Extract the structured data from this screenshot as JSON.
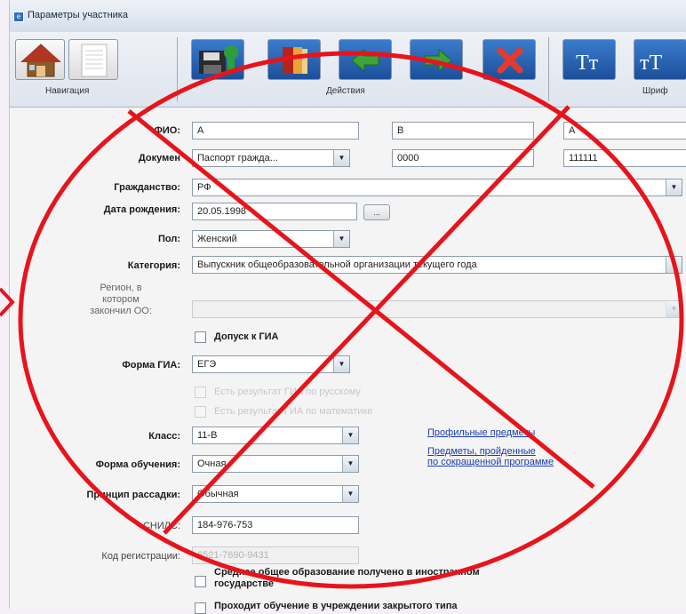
{
  "window": {
    "title": "Параметры участника"
  },
  "toolbar": {
    "groups": {
      "navigation": "Навигация",
      "actions": "Действия",
      "font": "Шриф"
    },
    "buttons": [
      {
        "name": "home-button",
        "icon": "home-icon"
      },
      {
        "name": "document-button",
        "icon": "document-icon"
      },
      {
        "name": "save-button",
        "icon": "save-icon"
      },
      {
        "name": "book-button",
        "icon": "book-icon"
      },
      {
        "name": "back-button",
        "icon": "arrow-left-icon"
      },
      {
        "name": "forward-button",
        "icon": "arrow-right-icon"
      },
      {
        "name": "delete-button",
        "icon": "close-icon"
      },
      {
        "name": "font-decrease-button",
        "icon": "font-size-icon",
        "label": "Tт"
      },
      {
        "name": "font-increase-button",
        "icon": "font-size-icon",
        "label": "тT"
      }
    ]
  },
  "form": {
    "fio": {
      "label": "ФИО:",
      "last": "А",
      "first": "В",
      "middle": "А"
    },
    "document": {
      "label": "Докумен",
      "type": "Паспорт гражда...",
      "series": "0000",
      "number": "111111"
    },
    "citizenship": {
      "label": "Гражданство:",
      "value": "РФ"
    },
    "birth_date": {
      "label": "Дата рождения:",
      "value": "20.05.1998",
      "picker_label": "..."
    },
    "sex": {
      "label": "Пол:",
      "value": "Женский"
    },
    "category": {
      "label": "Категория:",
      "value": "Выпускник общеобразовательной организации текущего года"
    },
    "region": {
      "label_l1": "Регион, в",
      "label_l2": "котором",
      "label_l3": "закончил ОО:",
      "value": ""
    },
    "gia_admission": {
      "label": "Допуск к ГИА",
      "checked": false
    },
    "gia_form": {
      "label": "Форма ГИА:",
      "value": "ЕГЭ"
    },
    "gia_russian": {
      "label": "Есть результат ГИА по русскому"
    },
    "gia_math": {
      "label": "Есть результат ГИА по математике"
    },
    "class": {
      "label": "Класс:",
      "value": "11-В"
    },
    "study_form": {
      "label": "Форма обучения:",
      "value": "Очная"
    },
    "seating": {
      "label": "Принцип рассадки:",
      "value": "Обычная"
    },
    "snils": {
      "label": "СНИЛС:",
      "value": "184-976-753"
    },
    "reg_code": {
      "label": "Код регистрации:",
      "value": "6521-7690-9431"
    },
    "links": {
      "profile_subjects": "Профильные предметы",
      "reduced_l1": "Предметы, пройденные",
      "reduced_l2": "по сокращенной программе"
    },
    "foreign_edu": {
      "label_l1": "Среднее общее образование получено в иностранном",
      "label_l2": "государстве"
    },
    "closed_institution": {
      "label": "Проходит обучение в учреждении закрытого типа"
    }
  },
  "colors": {
    "overlay_red": "#e8131b",
    "toolbar_blue": "#2a66b8"
  }
}
